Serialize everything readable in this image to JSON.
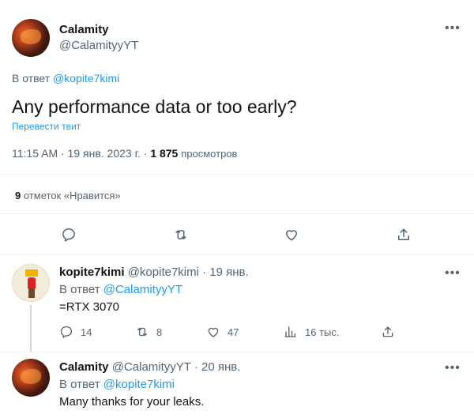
{
  "main_tweet": {
    "author_name": "Calamity",
    "author_handle": "@CalamityyYT",
    "reply_prefix": "В ответ",
    "reply_to": "@kopite7kimi",
    "text": "Any performance data or too early?",
    "translate": "Перевести твит",
    "timestamp": "11:15 AM · 19 янв. 2023 г. · ",
    "views_count": "1 875",
    "views_label": "просмотров",
    "likes_count": "9",
    "likes_label": "отметок «Нравится»"
  },
  "reply1": {
    "author_name": "kopite7kimi",
    "author_handle": "@kopite7kimi",
    "date": "· 19 янв.",
    "reply_prefix": "В ответ",
    "reply_to": "@CalamityyYT",
    "text": "=RTX 3070",
    "replies": "14",
    "retweets": "8",
    "likes": "47",
    "views": "16 тыс."
  },
  "reply2": {
    "author_name": "Calamity",
    "author_handle": "@CalamityyYT",
    "date": "· 20 янв.",
    "reply_prefix": "В ответ",
    "reply_to": "@kopite7kimi",
    "text": "Many thanks for your leaks."
  },
  "icons": {
    "more": "more-icon",
    "reply": "reply-icon",
    "retweet": "retweet-icon",
    "like": "heart-icon",
    "share": "share-icon",
    "views": "views-icon"
  },
  "colors": {
    "accent": "#1d9bf0",
    "text": "#0f1419",
    "secondary": "#536471",
    "divider": "#eff3f4"
  }
}
